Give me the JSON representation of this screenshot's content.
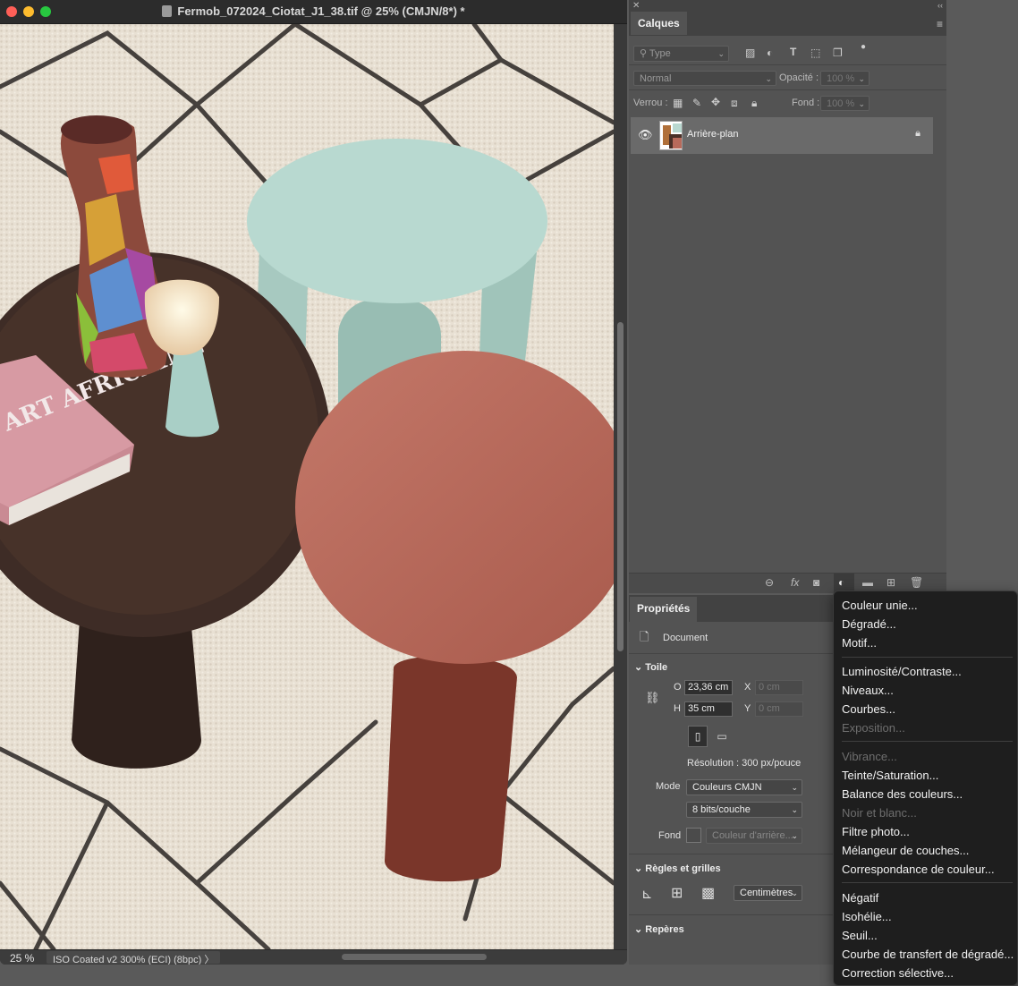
{
  "document": {
    "title": "Fermob_072024_Ciotat_J1_38.tif @ 25% (CMJN/8*) *",
    "zoom": "25 %",
    "color_profile": "ISO Coated v2 300% (ECI) (8bpc)",
    "profile_arrow": "〉"
  },
  "layers_panel": {
    "tab": "Calques",
    "filter_placeholder": "Type",
    "blend_mode": "Normal",
    "opacity_label": "Opacité :",
    "opacity_value": "100 %",
    "lock_label": "Verrou :",
    "fill_label": "Fond :",
    "fill_value": "100 %",
    "layers": [
      {
        "name": "Arrière-plan",
        "visible": true,
        "locked": true
      }
    ]
  },
  "properties_panel": {
    "tab": "Propriétés",
    "type_label": "Document",
    "canvas_section": "Toile",
    "width_label": "O",
    "width_value": "23,36 cm",
    "height_label": "H",
    "height_value": "35 cm",
    "x_label": "X",
    "x_placeholder": "0 cm",
    "y_label": "Y",
    "y_placeholder": "0 cm",
    "resolution": "Résolution : 300 px/pouce",
    "mode_label": "Mode",
    "mode_value": "Couleurs CMJN",
    "depth_value": "8 bits/couche",
    "fill_label": "Fond",
    "fill_value": "Couleur d'arrière...",
    "rulers_section": "Règles et grilles",
    "units_value": "Centimètres",
    "guides_section": "Repères"
  },
  "adjustment_menu": {
    "groups": [
      [
        {
          "label": "Couleur unie...",
          "enabled": true
        },
        {
          "label": "Dégradé...",
          "enabled": true
        },
        {
          "label": "Motif...",
          "enabled": true
        }
      ],
      [
        {
          "label": "Luminosité/Contraste...",
          "enabled": true
        },
        {
          "label": "Niveaux...",
          "enabled": true
        },
        {
          "label": "Courbes...",
          "enabled": true
        },
        {
          "label": "Exposition...",
          "enabled": false
        }
      ],
      [
        {
          "label": "Vibrance...",
          "enabled": false
        },
        {
          "label": "Teinte/Saturation...",
          "enabled": true
        },
        {
          "label": "Balance des couleurs...",
          "enabled": true
        },
        {
          "label": "Noir et blanc...",
          "enabled": false
        },
        {
          "label": "Filtre photo...",
          "enabled": true
        },
        {
          "label": "Mélangeur de couches...",
          "enabled": true
        },
        {
          "label": "Correspondance de couleur...",
          "enabled": true
        }
      ],
      [
        {
          "label": "Négatif",
          "enabled": true
        },
        {
          "label": "Isohélie...",
          "enabled": true
        },
        {
          "label": "Seuil...",
          "enabled": true
        },
        {
          "label": "Courbe de transfert de dégradé...",
          "enabled": true
        },
        {
          "label": "Correction sélective...",
          "enabled": true
        }
      ]
    ]
  },
  "photo_book_text": "ART AFRICAINE",
  "colors": {
    "panel_bg": "#535353",
    "menu_bg": "#1e1e1e",
    "rug": "#e9e1d4",
    "table_brown": "#3c2a24",
    "table_mint": "#b5d6cd",
    "table_terracotta": "#b96a5c"
  }
}
